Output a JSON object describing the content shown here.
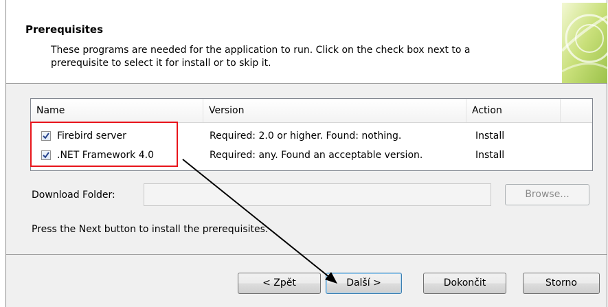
{
  "header": {
    "title": "Prerequisites",
    "description": "These programs are needed for the application to run. Click on the check box next to a prerequisite to select it for install or to skip it."
  },
  "list": {
    "columns": [
      "Name",
      "Version",
      "Action"
    ],
    "rows": [
      {
        "name": "Firebird server",
        "version": "Required: 2.0 or higher. Found: nothing.",
        "action": "Install",
        "checked": true
      },
      {
        "name": ".NET Framework 4.0",
        "version": "Required: any. Found an acceptable version.",
        "action": "Install",
        "checked": true
      }
    ]
  },
  "download": {
    "label": "Download Folder:",
    "value": "",
    "browse_label": "Browse..."
  },
  "hint": "Press the Next button to install the prerequisites.",
  "buttons": {
    "back": "< Zpět",
    "next": "Další >",
    "finish": "Dokončit",
    "cancel": "Storno"
  },
  "annotation": {
    "highlight_color": "#e8141b",
    "arrow_color": "#000000"
  }
}
